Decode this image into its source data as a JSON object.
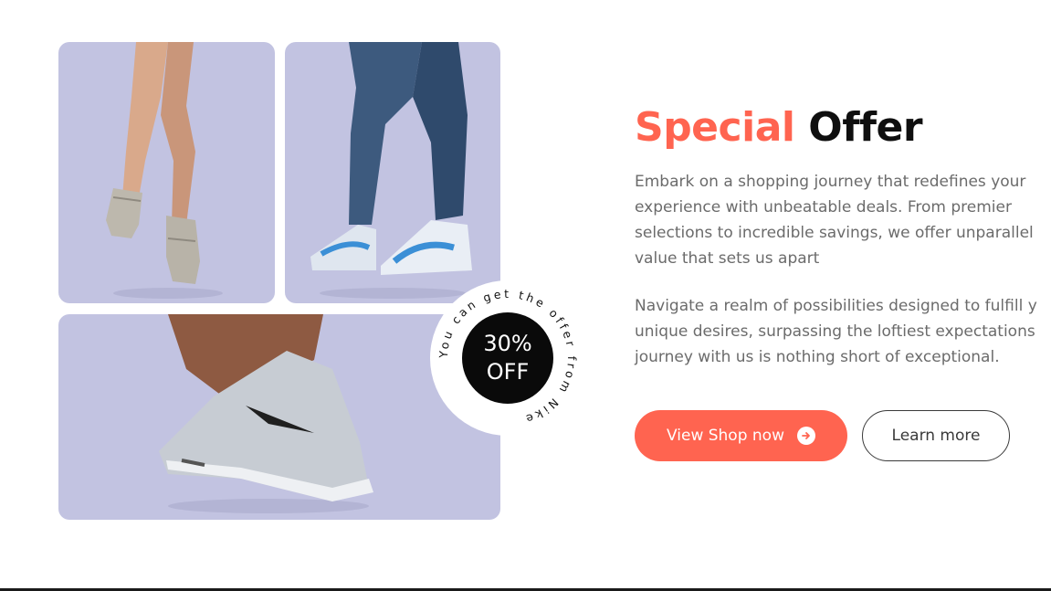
{
  "images": [
    {
      "name": "legs-sneakers-photo",
      "description": "photo"
    },
    {
      "name": "jeans-sneakers-photo",
      "description": "photo"
    },
    {
      "name": "foot-sneaker-photo",
      "description": "photo"
    }
  ],
  "badge": {
    "discount_line1": "30%",
    "discount_line2": "OFF",
    "circular_text": "You can get the offer from Nike"
  },
  "offer": {
    "title_accent": "Special",
    "title_rest": "Offer",
    "paragraph1_lines": [
      "Embark on a shopping journey that redefines your",
      "experience with unbeatable deals. From premier",
      "selections to incredible savings, we offer unparallel",
      "value that sets us apart"
    ],
    "paragraph2_lines": [
      "Navigate a realm of possibilities designed to fulfill y",
      "unique desires, surpassing the loftiest expectations",
      "journey with us is nothing short of exceptional."
    ]
  },
  "buttons": {
    "primary_label": "View Shop now",
    "secondary_label": "Learn more"
  },
  "colors": {
    "accent": "#ff6450",
    "photo_bg": "#c2c3e1",
    "title_dark": "#0f0f0f",
    "body_text": "#6b6b6b"
  },
  "icons": {
    "primary_button_icon": "arrow-right-circle-icon"
  }
}
